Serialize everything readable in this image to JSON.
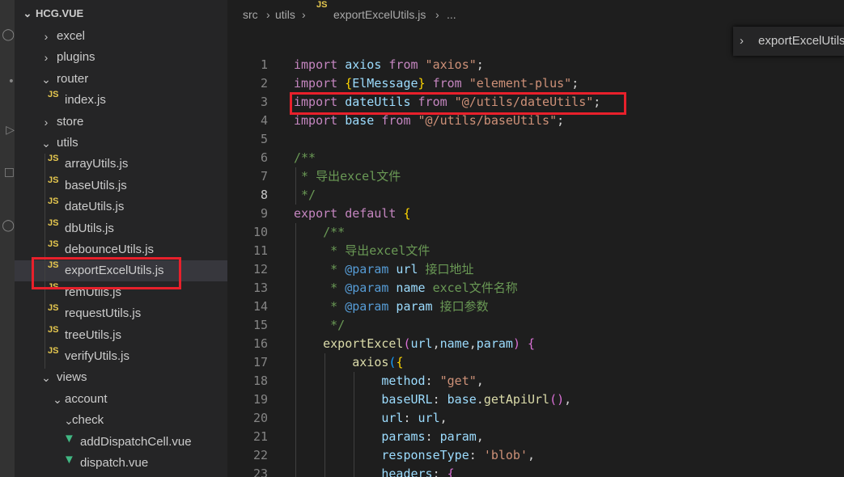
{
  "explorer": {
    "title": "HCG.VUE",
    "items": [
      {
        "label": "excel",
        "type": "folder",
        "expanded": false,
        "depth": 1
      },
      {
        "label": "plugins",
        "type": "folder",
        "expanded": false,
        "depth": 1
      },
      {
        "label": "router",
        "type": "folder",
        "expanded": true,
        "depth": 1
      },
      {
        "label": "index.js",
        "type": "js",
        "depth": 2
      },
      {
        "label": "store",
        "type": "folder",
        "expanded": false,
        "depth": 1
      },
      {
        "label": "utils",
        "type": "folder",
        "expanded": true,
        "depth": 1
      },
      {
        "label": "arrayUtils.js",
        "type": "js",
        "depth": 2
      },
      {
        "label": "baseUtils.js",
        "type": "js",
        "depth": 2
      },
      {
        "label": "dateUtils.js",
        "type": "js",
        "depth": 2
      },
      {
        "label": "dbUtils.js",
        "type": "js",
        "depth": 2
      },
      {
        "label": "debounceUtils.js",
        "type": "js",
        "depth": 2
      },
      {
        "label": "exportExcelUtils.js",
        "type": "js",
        "depth": 2,
        "selected": true
      },
      {
        "label": "remUtils.js",
        "type": "js",
        "depth": 2
      },
      {
        "label": "requestUtils.js",
        "type": "js",
        "depth": 2
      },
      {
        "label": "treeUtils.js",
        "type": "js",
        "depth": 2
      },
      {
        "label": "verifyUtils.js",
        "type": "js",
        "depth": 2
      },
      {
        "label": "views",
        "type": "folder",
        "expanded": true,
        "depth": 1
      },
      {
        "label": "account",
        "type": "folder",
        "expanded": true,
        "depth": 2
      },
      {
        "label": "check",
        "type": "folder",
        "expanded": true,
        "depth": 3
      },
      {
        "label": "addDispatchCell.vue",
        "type": "vue",
        "depth": 4
      },
      {
        "label": "dispatch.vue",
        "type": "vue",
        "depth": 4
      }
    ]
  },
  "icons": {
    "js": "JS",
    "chevron_right": "›",
    "chevron_down": "⌄",
    "vue": "▼"
  },
  "breadcrumb": {
    "parts": [
      "src",
      "utils",
      "exportExcelUtils.js",
      "..."
    ],
    "sep": "›"
  },
  "sticky_scroll": {
    "label": "exportExcelUtils"
  },
  "editor": {
    "current_line": 8,
    "lines": [
      {
        "n": "1"
      },
      {
        "n": "2"
      },
      {
        "n": "3"
      },
      {
        "n": "4"
      },
      {
        "n": "5"
      },
      {
        "n": "6"
      },
      {
        "n": "7"
      },
      {
        "n": "8"
      },
      {
        "n": "9"
      },
      {
        "n": "10"
      },
      {
        "n": "11"
      },
      {
        "n": "12"
      },
      {
        "n": "13"
      },
      {
        "n": "14"
      },
      {
        "n": "15"
      },
      {
        "n": "16"
      },
      {
        "n": "17"
      },
      {
        "n": "18"
      },
      {
        "n": "19"
      },
      {
        "n": "20"
      },
      {
        "n": "21"
      },
      {
        "n": "22"
      },
      {
        "n": "23"
      }
    ],
    "code": {
      "l1": [
        "import",
        " axios",
        " from",
        " \"axios\"",
        ";"
      ],
      "l2": [
        "import",
        " {",
        "ElMessage",
        "}",
        " from",
        " \"element-plus\"",
        ";"
      ],
      "l3": [
        "import",
        " dateUtils",
        " from",
        " \"@/utils/dateUtils\"",
        ";"
      ],
      "l4": [
        "import",
        " base",
        " from",
        " \"@/utils/baseUtils\"",
        ";"
      ],
      "l6": "/**",
      "l7": " * 导出excel文件",
      "l8": " */",
      "l9": [
        "export",
        " default",
        " {"
      ],
      "l10": "    /**",
      "l11": "     * 导出excel文件",
      "l12": [
        "     * ",
        "@param",
        " url",
        " 接口地址"
      ],
      "l13": [
        "     * ",
        "@param",
        " name",
        " excel文件名称"
      ],
      "l14": [
        "     * ",
        "@param",
        " param",
        " 接口参数"
      ],
      "l15": "     */",
      "l16": [
        "    ",
        "exportExcel",
        "(",
        "url",
        ",",
        "name",
        ",",
        "param",
        ")",
        " {"
      ],
      "l17": [
        "        ",
        "axios",
        "(",
        "{"
      ],
      "l18": [
        "            ",
        "method",
        ": ",
        "\"get\"",
        ","
      ],
      "l19": [
        "            ",
        "baseURL",
        ": ",
        "base",
        ".",
        "getApiUrl",
        "()",
        ","
      ],
      "l20": [
        "            ",
        "url",
        ": ",
        "url",
        ","
      ],
      "l21": [
        "            ",
        "params",
        ": ",
        "param",
        ","
      ],
      "l22": [
        "            ",
        "responseType",
        ": ",
        "'blob'",
        ","
      ],
      "l23": [
        "            ",
        "headers",
        ": ",
        "{"
      ]
    }
  }
}
